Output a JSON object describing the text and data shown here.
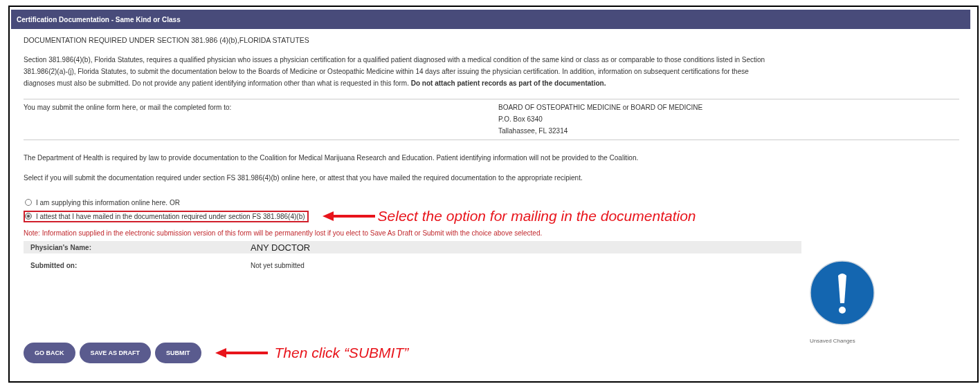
{
  "panel": {
    "title": "Certification Documentation - Same Kind or Class"
  },
  "heading": "DOCUMENTATION REQUIRED UNDER SECTION 381.986 (4)(b),FLORIDA STATUTES",
  "intro": "Section 381.986(4)(b), Florida Statutes, requires a qualified physician who issues a physician certification for a qualified patient diagnosed with a medical condition of the same kind or class as or comparable to those conditions listed in Section 381.986(2)(a)-(j), Florida Statutes, to submit the documentation below to the Boards of Medicine or Osteopathic Medicine within 14 days after issuing the physician certification. In addition, information on subsequent certifications for these diagnoses must also be submitted. Do not provide any patient identifying information other than what is requested in this form. **Do not attach patient records as part of the documentation.**",
  "mail": {
    "label": "You may submit the online form here, or mail the completed form to:",
    "address": [
      "BOARD OF OSTEOPATHIC MEDICINE or BOARD OF MEDICINE",
      "P.O. Box 6340",
      "Tallahassee, FL 32314"
    ]
  },
  "notices": [
    "The Department of Health is required by law to provide documentation to the Coalition for Medical Marijuana Research and Education. Patient identifying information will not be provided to the Coalition.",
    "Select if you will submit the documentation required under section FS 381.986(4)(b) online here, or attest that you have mailed the required documentation to the appropriate recipient."
  ],
  "options": [
    {
      "label": "I am supplying this information online here. OR",
      "selected": false,
      "highlighted": false
    },
    {
      "label": "I attest that I have mailed in the documentation required under section FS 381.986(4)(b)",
      "selected": true,
      "highlighted": true,
      "callout": "Select the option for mailing in the documentation"
    }
  ],
  "warning": "Note: Information supplied in the electronic submission version of this form will be permanently lost if you elect to Save As Draft or Submit with the choice above selected.",
  "details": [
    {
      "label": "Physician's Name:",
      "value": "ANY DOCTOR",
      "shaded": true
    },
    {
      "label": "Submitted on:",
      "value": "Not yet submitted",
      "shaded": false
    }
  ],
  "buttons": [
    {
      "label": "GO BACK"
    },
    {
      "label": "SAVE AS DRAFT"
    },
    {
      "label": "SUBMIT",
      "callout": "Then click “SUBMIT”"
    }
  ],
  "status": {
    "label": "Unsaved Changes"
  }
}
